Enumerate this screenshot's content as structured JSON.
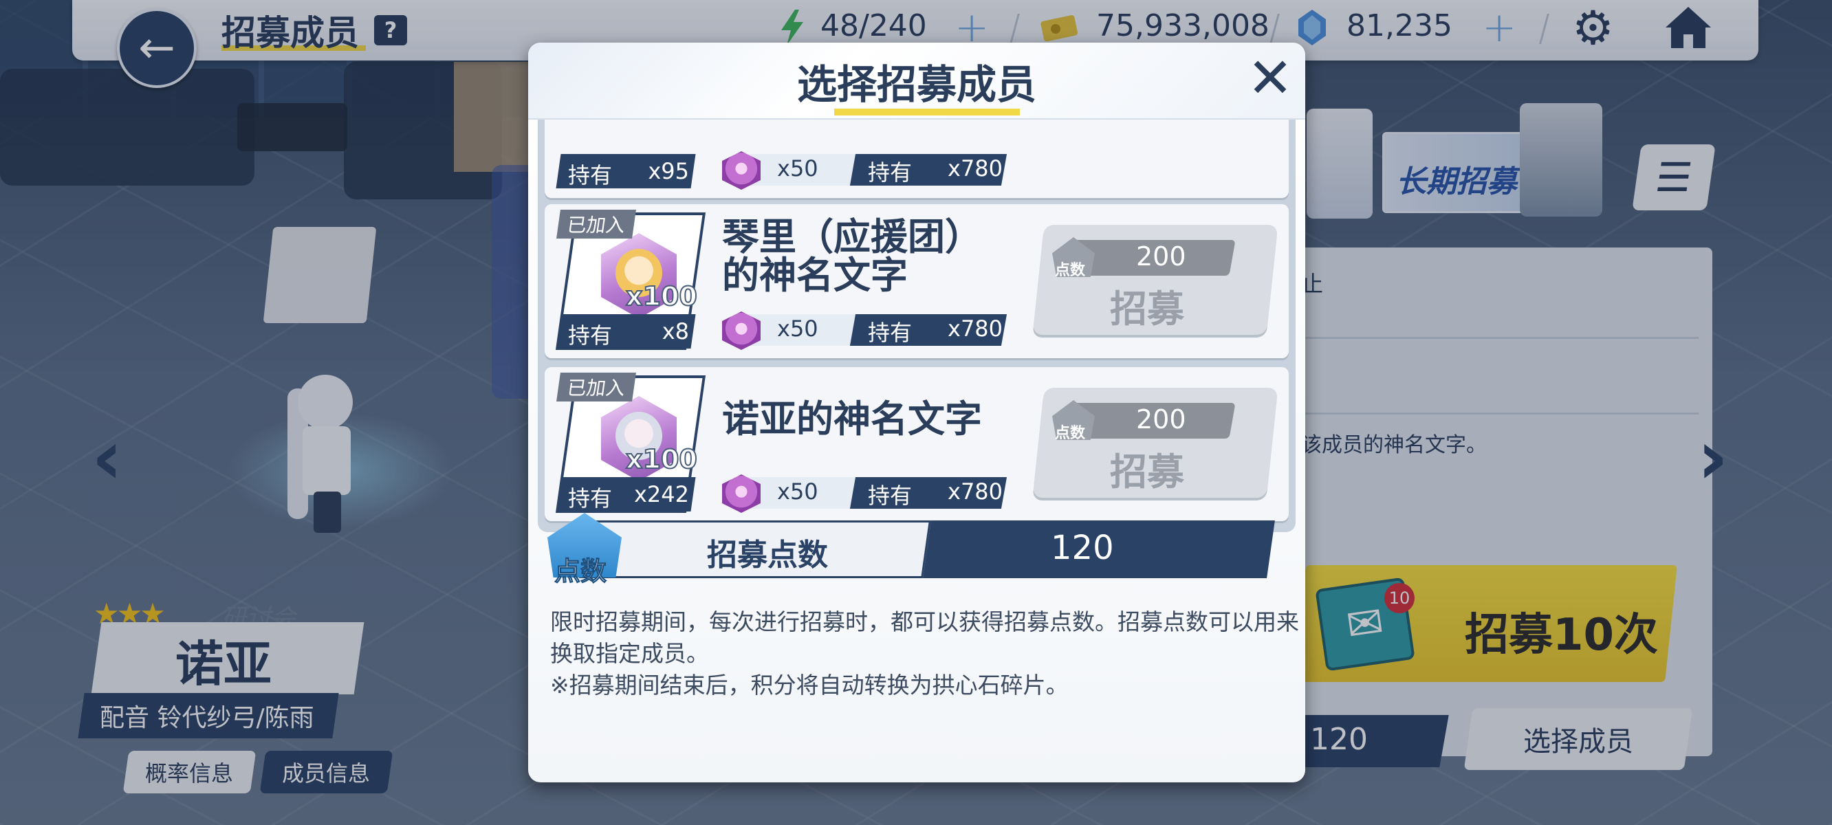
{
  "topbar": {
    "title": "招募成员",
    "help": "?",
    "stamina": "48/240",
    "credits": "75,933,008",
    "gems": "81,235"
  },
  "left_info": {
    "stars": "★★★",
    "club": "研讨会",
    "name": "诺亚",
    "voice": "配音 铃代纱弓/陈雨",
    "prob_button": "概率信息",
    "member_button": "成员信息"
  },
  "right_side": {
    "banner": "长期招募",
    "status_text": "止",
    "desc_text": "该成员的神名文字。",
    "recruit10_badge": "10",
    "recruit10_label": "招募10次",
    "points": "120",
    "select_button": "选择成员"
  },
  "modal": {
    "title": "选择招募成员",
    "partial_item": {
      "own_label": "持有",
      "own_value": "x95",
      "cost": "x50",
      "own2_label": "持有",
      "own2_value": "x780"
    },
    "items": [
      {
        "joined": "已加入",
        "portrait_qty": "x100",
        "own_label": "持有",
        "own_value": "x8",
        "name": "琴里（应援团）的神名文字",
        "cost": "x50",
        "own2_label": "持有",
        "own2_value": "x780",
        "points_icon": "点数",
        "points": "200",
        "recruit_label": "招募"
      },
      {
        "joined": "已加入",
        "portrait_qty": "x100",
        "own_label": "持有",
        "own_value": "x242",
        "name": "诺亚的神名文字",
        "cost": "x50",
        "own2_label": "持有",
        "own2_value": "x780",
        "points_icon": "点数",
        "points": "200",
        "recruit_label": "招募"
      }
    ],
    "points_icon_label": "点数",
    "points_label": "招募点数",
    "points_value": "120",
    "description_line1": "限时招募期间，每次进行招募时，都可以获得招募点数。招募点数可以用来换取指定成员。",
    "description_line2": "※招募期间结束后，积分将自动转换为拱心石碎片。"
  },
  "icons": {
    "back": "back-arrow-icon",
    "stamina": "lightning-icon",
    "credits": "credit-card-icon",
    "gems": "pyroxene-gem-icon",
    "settings": "gear-icon",
    "home": "home-icon",
    "close": "close-icon",
    "menu": "hamburger-menu-icon"
  },
  "colors": {
    "navy": "#2a4266",
    "accent_yellow": "#f1d846",
    "recruit_yellow": "#f6de40"
  }
}
